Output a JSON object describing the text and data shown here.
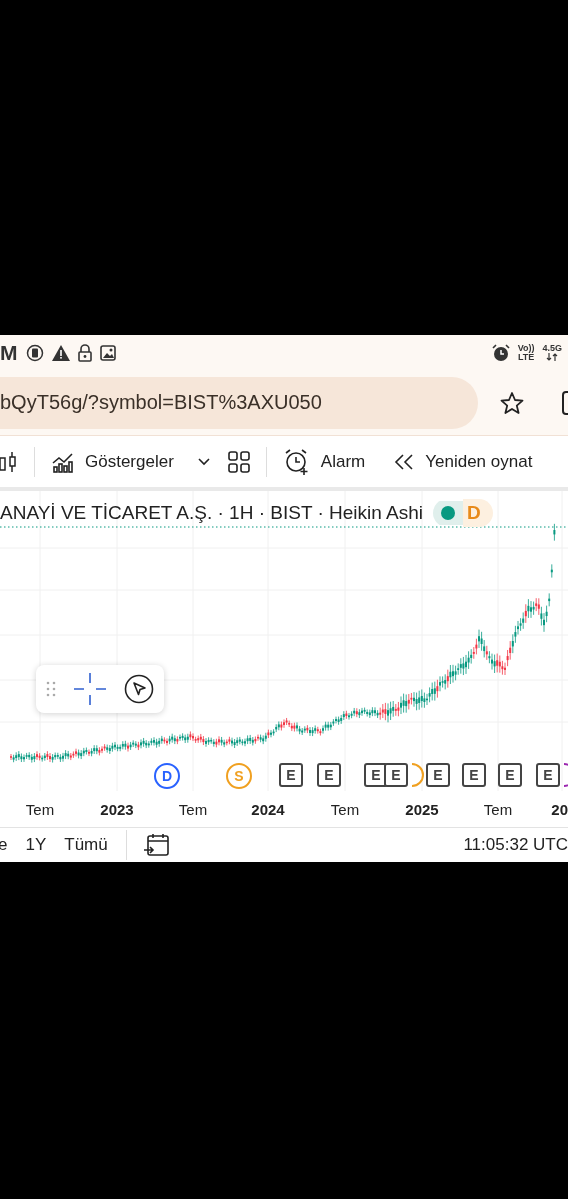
{
  "status_bar": {
    "left_letter": "M",
    "volte": "Vo))",
    "network": "LTE",
    "generation": "4.5G"
  },
  "address_bar": {
    "url": "bQyT56g/?symbol=BIST%3AXU050"
  },
  "toolbar": {
    "items": [
      {
        "kind": "indicators",
        "label": "Göstergeler"
      },
      {
        "kind": "alarm",
        "label": "Alarm"
      },
      {
        "kind": "replay",
        "label": "Yeniden oynat"
      }
    ]
  },
  "legend": {
    "title": "ANAYİ VE TİCARET A.Ş. · 1H · BIST · Heikin Ashi",
    "badge": "D"
  },
  "events": [
    {
      "label": "D",
      "kind": "dividend"
    },
    {
      "label": "S",
      "kind": "split"
    },
    {
      "label": "E",
      "kind": "earnings"
    },
    {
      "label": "E",
      "kind": "earnings"
    },
    {
      "label": "E",
      "kind": "earnings"
    },
    {
      "label": "E",
      "kind": "earnings"
    },
    {
      "label": "E",
      "kind": "earnings"
    },
    {
      "label": "E",
      "kind": "earnings"
    },
    {
      "label": "E",
      "kind": "earnings"
    },
    {
      "label": "E",
      "kind": "earnings"
    }
  ],
  "time_axis": [
    {
      "label": "Tem",
      "year": false
    },
    {
      "label": "2023",
      "year": true
    },
    {
      "label": "Tem",
      "year": false
    },
    {
      "label": "2024",
      "year": true
    },
    {
      "label": "Tem",
      "year": false
    },
    {
      "label": "2025",
      "year": true
    },
    {
      "label": "Tem",
      "year": false
    },
    {
      "label": "20",
      "year": true
    }
  ],
  "bottom_bar": {
    "ranges": [
      {
        "label": "e"
      },
      {
        "label": "1Y"
      },
      {
        "label": "Tümü"
      }
    ],
    "time": "11:05:32 UTC"
  }
}
